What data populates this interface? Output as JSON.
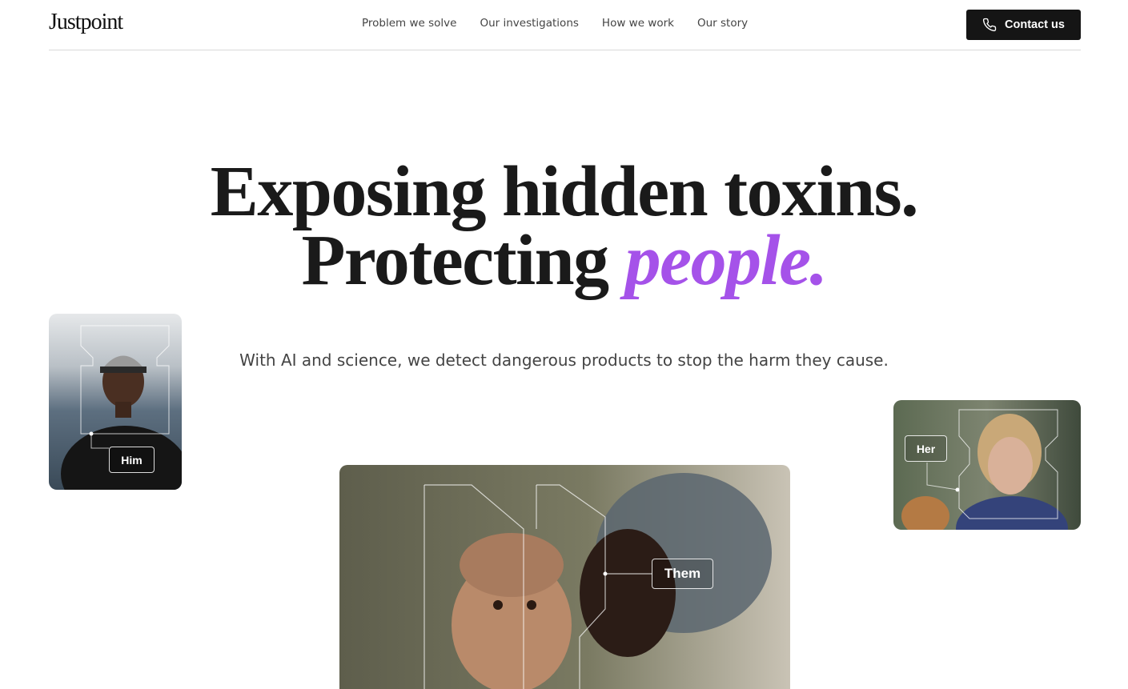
{
  "header": {
    "logo": "Justpoint",
    "nav": [
      "Problem we solve",
      "Our investigations",
      "How we work",
      "Our story"
    ],
    "contact_label": "Contact us"
  },
  "hero": {
    "line1": "Exposing hidden toxins.",
    "line2_prefix": "Protecting ",
    "line2_accent": "people.",
    "subtitle": "With AI and science, we detect dangerous products to stop the harm they cause."
  },
  "cards": {
    "him_label": "Him",
    "her_label": "Her",
    "them_label": "Them"
  },
  "colors": {
    "accent": "#a552e9",
    "button_bg": "#151515",
    "text": "#1a1a1a"
  }
}
